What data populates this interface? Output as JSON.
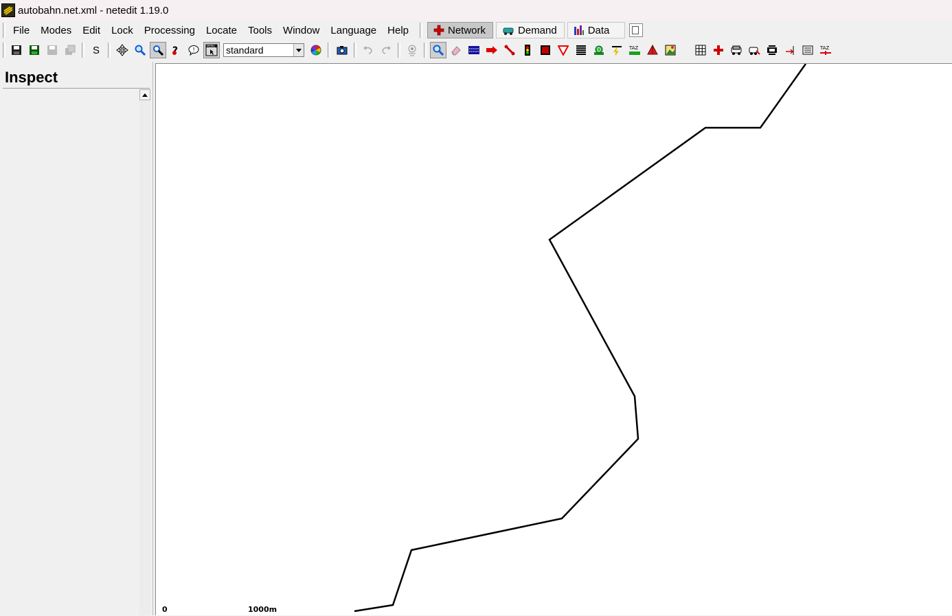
{
  "window": {
    "title": "autobahn.net.xml - netedit 1.19.0"
  },
  "menu": {
    "items": [
      {
        "label": "File"
      },
      {
        "label": "Modes"
      },
      {
        "label": "Edit"
      },
      {
        "label": "Lock"
      },
      {
        "label": "Processing"
      },
      {
        "label": "Locate"
      },
      {
        "label": "Tools"
      },
      {
        "label": "Window"
      },
      {
        "label": "Language"
      },
      {
        "label": "Help"
      }
    ]
  },
  "supermodes": {
    "network": "Network",
    "demand": "Demand",
    "data": "Data"
  },
  "toolbar": {
    "s_label": "S",
    "scheme_value": "standard"
  },
  "panel": {
    "title": "Inspect"
  },
  "scale": {
    "zero": "0",
    "length": "1000m"
  },
  "colors": {
    "network_icon": "#d00000",
    "edge": "#000000",
    "canvas": "#ffffff"
  }
}
